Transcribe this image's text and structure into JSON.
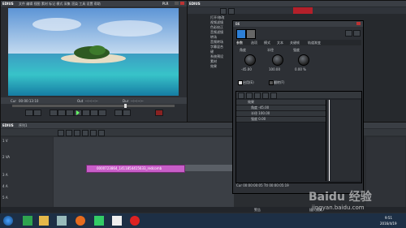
{
  "player": {
    "title": "EDIUS",
    "menu": [
      "文件",
      "编辑",
      "视图",
      "素材",
      "标记",
      "模式",
      "采集",
      "渲染",
      "工具",
      "设置",
      "帮助"
    ],
    "mode_label": "PLR",
    "in_label": "Cur",
    "in_tc": "00:00:13:10",
    "out_label": "Out",
    "out_tc": "--:--:--:--",
    "dur_label": "Dur",
    "dur_tc": "--:--:--:--",
    "ttl_label": "Ttl",
    "ttl_tc": "00:00:05:19"
  },
  "bin": {
    "title": "EDIUS",
    "tree": [
      "打开/修改",
      "视频滤镜",
      "色彩校正",
      "音频滤镜",
      "转场",
      "音频转场",
      "字幕混合",
      "键",
      "系统预设",
      "素材",
      "效果"
    ]
  },
  "effect_dialog": {
    "title": "B6",
    "tabs": [
      "参数",
      "选项",
      "模式",
      "文本",
      "关键帧",
      "轨道渐变"
    ],
    "knobs": [
      {
        "label": "角度",
        "value": "-45.00"
      },
      {
        "label": "半径",
        "value": "100.00"
      },
      {
        "label": "强度",
        "value": "0.00 %"
      }
    ],
    "checks": [
      {
        "label": "启用(E)",
        "checked": true
      },
      {
        "label": "翻转(F)",
        "checked": false
      }
    ],
    "rows": [
      {
        "label": "效果",
        "value": ""
      },
      {
        "label": "角度",
        "value": "-45.00"
      },
      {
        "label": "半径",
        "value": "100.00"
      },
      {
        "label": "强度",
        "value": "0.00"
      }
    ],
    "footer": "Cur 00:00:00:05   Ttl 00:00:05:19"
  },
  "timeline": {
    "title": "EDIUS",
    "sequence": "序列1",
    "clip_name": "0000723864_1411854415633_redcomb",
    "tracks": [
      "1 V",
      "2 VA",
      "3 A",
      "4 A",
      "5 A"
    ],
    "status_items": [
      "警告",
      "插入模式"
    ]
  },
  "watermark": "Baidu 经验",
  "watermark_url": "jingyan.baidu.com",
  "taskbar": {
    "time": "9:51",
    "date": "2016/4/19"
  }
}
